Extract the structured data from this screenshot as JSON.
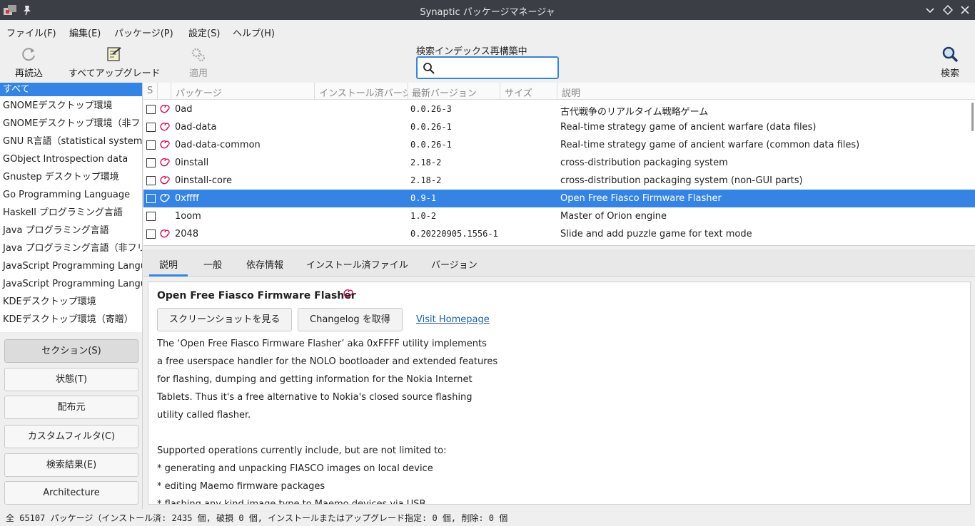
{
  "window": {
    "title": "Synaptic パッケージマネージャ"
  },
  "menu": [
    "ファイル(F)",
    "編集(E)",
    "パッケージ(P)",
    "設定(S)",
    "ヘルプ(H)"
  ],
  "toolbar": {
    "reload": "再読込",
    "upgrade_all": "すべてアップグレード",
    "apply": "適用",
    "search": "検索",
    "search_status": "検索インデックス再構築中",
    "search_value": "",
    "search_placeholder": ""
  },
  "sections": [
    "すべて",
    "GNOMEデスクトップ環境",
    "GNOMEデスクトップ環境（非フリー）",
    "GNU R言語（statistical system）",
    "GObject Introspection data",
    "Gnustep デスクトップ環境",
    "Go Programming Language",
    "Haskell プログラミング言語",
    "Java プログラミング言語",
    "Java プログラミング言語（非フリー）",
    "JavaScript Programming Language",
    "JavaScript Programming Language",
    "KDEデスクトップ環境",
    "KDEデスクトップ環境（寄贈）"
  ],
  "filter_buttons": [
    "セクション(S)",
    "状態(T)",
    "配布元",
    "カスタムフィルタ(C)",
    "検索結果(E)",
    "Architecture"
  ],
  "columns": {
    "s": "S",
    "package": "パッケージ",
    "installed": "インストール済バージョン",
    "latest": "最新バージョン",
    "size": "サイズ",
    "description": "説明"
  },
  "packages": [
    {
      "name": "0ad",
      "latest": "0.0.26-3",
      "description": "古代戦争のリアルタイム戦略ゲーム",
      "debian": true
    },
    {
      "name": "0ad-data",
      "latest": "0.0.26-1",
      "description": "Real-time strategy game of ancient warfare (data files)",
      "debian": true
    },
    {
      "name": "0ad-data-common",
      "latest": "0.0.26-1",
      "description": "Real-time strategy game of ancient warfare (common data files)",
      "debian": true
    },
    {
      "name": "0install",
      "latest": "2.18-2",
      "description": "cross-distribution packaging system",
      "debian": true
    },
    {
      "name": "0install-core",
      "latest": "2.18-2",
      "description": "cross-distribution packaging system (non-GUI parts)",
      "debian": true
    },
    {
      "name": "0xffff",
      "latest": "0.9-1",
      "description": "Open Free Fiasco Firmware Flasher",
      "debian": true,
      "selected": true
    },
    {
      "name": "1oom",
      "latest": "1.0-2",
      "description": "Master of Orion engine",
      "debian": false
    },
    {
      "name": "2048",
      "latest": "0.20220905.1556-1",
      "description": "Slide and add puzzle game for text mode",
      "debian": true
    }
  ],
  "tabs": [
    "説明",
    "一般",
    "依存情報",
    "インストール済ファイル",
    "バージョン"
  ],
  "detail": {
    "title": "Open Free Fiasco Firmware Flasher",
    "screenshot_button": "スクリーンショットを見る",
    "changelog_button": "Changelog を取得",
    "homepage_link": "Visit Homepage",
    "lines": [
      "The ‘Open Free Fiasco Firmware Flasher’ aka 0xFFFF utility implements",
      "a free userspace handler for the NOLO bootloader and extended features",
      "for flashing, dumping and getting information for the Nokia Internet",
      "Tablets. Thus it's a free alternative to Nokia's closed source flashing",
      "utility called flasher.",
      "",
      "Supported operations currently include, but are not limited to:",
      " * generating and unpacking FIASCO images on local device",
      " * editing Maemo firmware packages",
      " * flashing any kind image type to Maemo devices via USB"
    ]
  },
  "status": "全 65107 パッケージ（インストール済: 2435 個, 破損 0 個, インストールまたはアップグレード指定: 0 個, 削除: 0 個",
  "colors": {
    "selection": "#3584e4",
    "titlebar": "#3b3f45",
    "debian_red": "#d70751",
    "link": "#1a5fb4"
  }
}
